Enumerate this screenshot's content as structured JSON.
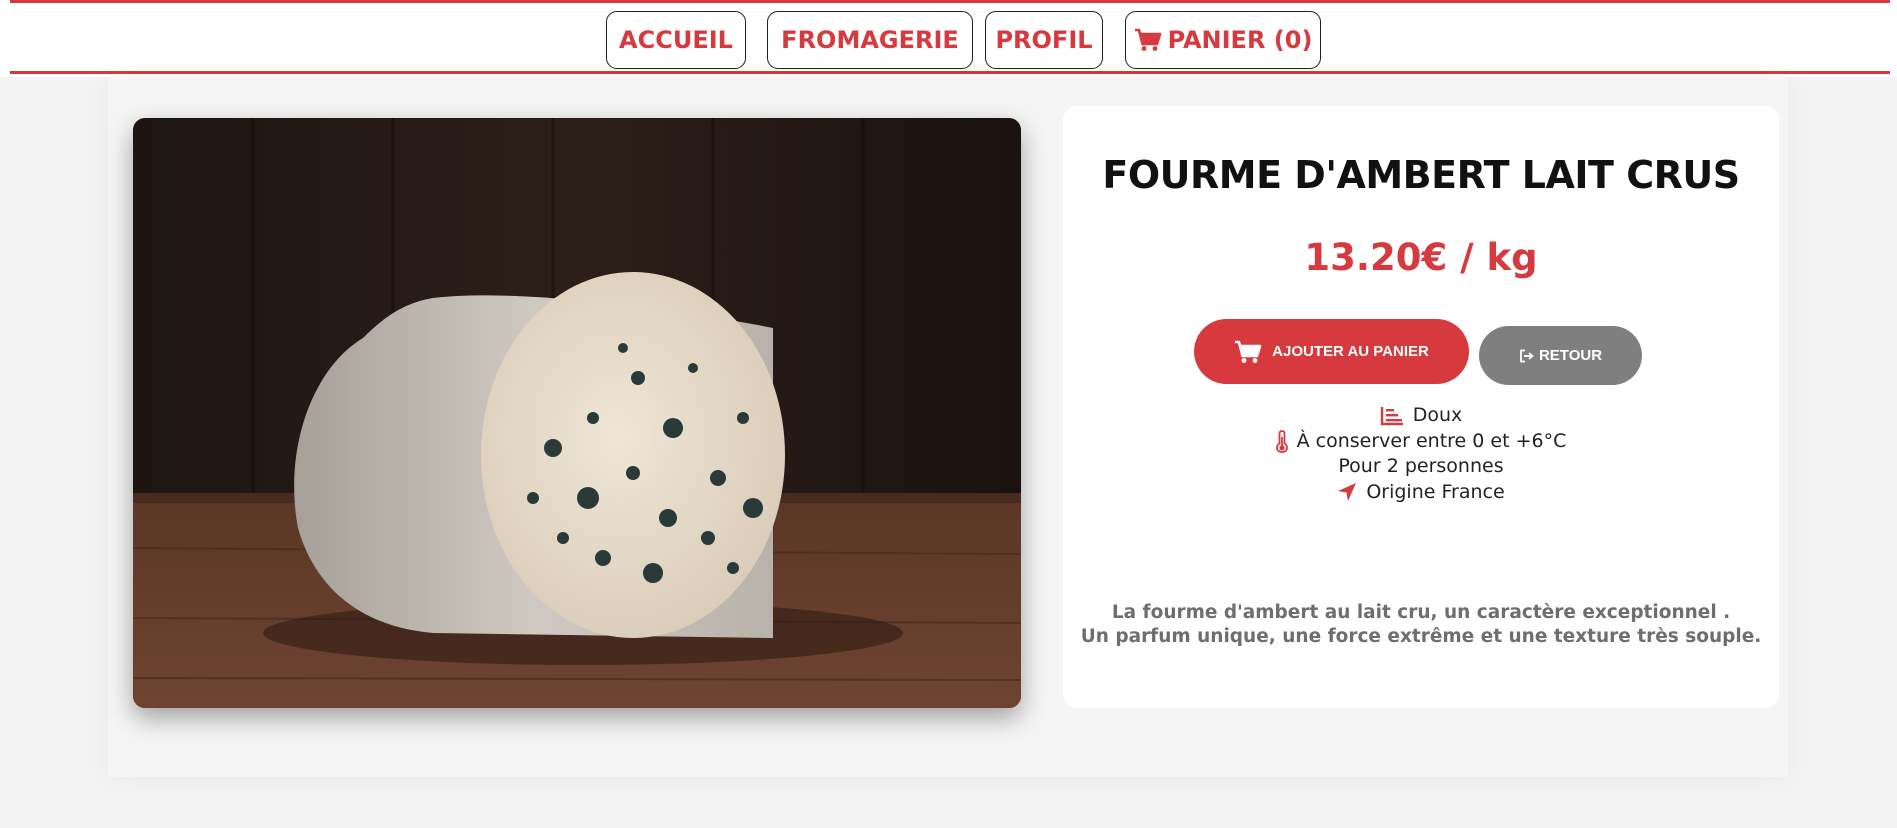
{
  "nav": {
    "accueil": "ACCUEIL",
    "fromagerie": "FROMAGERIE",
    "profil": "PROFIL",
    "panier": "PANIER (0)"
  },
  "product": {
    "name": "FOURME D'AMBERT LAIT CRUS",
    "price": "13.20€ / kg",
    "add_to_cart": "AJOUTER AU PANIER",
    "back": "RETOUR",
    "features": {
      "taste": "Doux",
      "storage": "À conserver entre 0 et +6°C",
      "servings": "Pour 2 personnes",
      "origin": "Origine France"
    },
    "description": [
      "La fourme d'ambert au lait cru, un caractère exceptionnel .",
      "Un parfum unique, une force extrême et une texture très souple."
    ]
  },
  "icons": {
    "cart": "cart-icon",
    "sign_out": "sign-out-icon",
    "chart": "chart-bar-icon",
    "thermometer": "thermometer-icon",
    "location": "location-arrow-icon"
  },
  "colors": {
    "accent": "#d63a3f",
    "back_button": "#7f7f7f",
    "page_background": "#f3f4f3"
  }
}
